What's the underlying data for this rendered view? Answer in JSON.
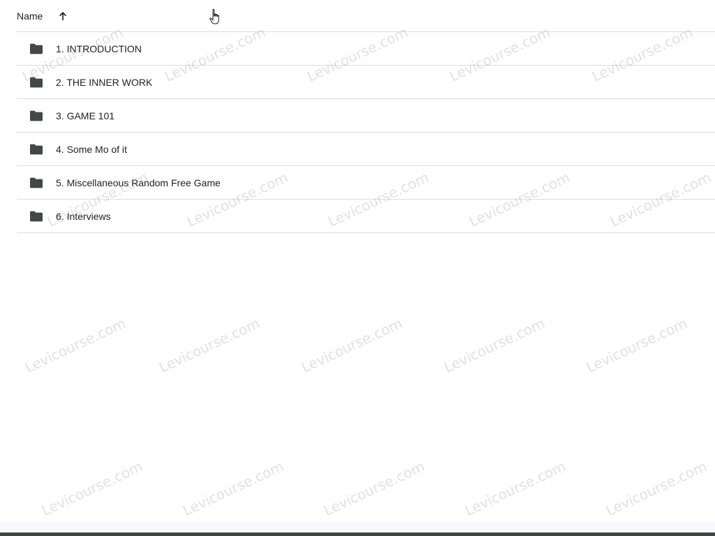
{
  "header": {
    "name_label": "Name",
    "sort_icon": "arrow-up-icon"
  },
  "folders": [
    {
      "label": "1. INTRODUCTION",
      "icon": "folder-icon"
    },
    {
      "label": "2. THE INNER WORK",
      "icon": "folder-icon"
    },
    {
      "label": "3. GAME 101",
      "icon": "folder-icon"
    },
    {
      "label": "4. Some Mo of it",
      "icon": "folder-icon"
    },
    {
      "label": "5. Miscellaneous Random Free Game",
      "icon": "folder-icon"
    },
    {
      "label": "6. Interviews",
      "icon": "folder-icon"
    }
  ],
  "watermark": {
    "text": "Levicourse.com"
  },
  "colors": {
    "text": "#1f1f1f",
    "divider": "#dadce0",
    "icon": "#444746"
  }
}
